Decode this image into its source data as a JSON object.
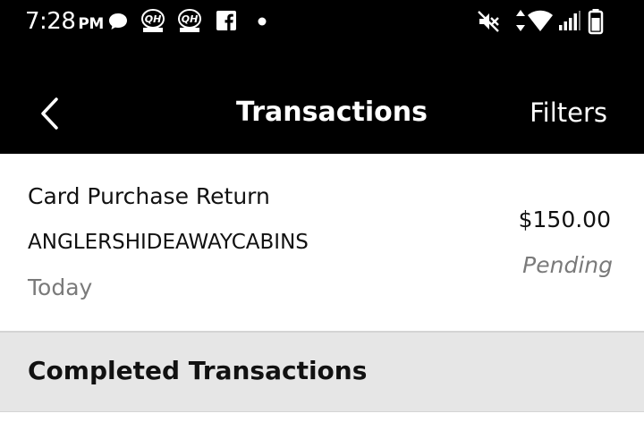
{
  "status_bar": {
    "time": "7:28",
    "ampm": "PM",
    "icons": [
      "chat-bubble-icon",
      "qh-slots-icon",
      "qh-slots-icon",
      "facebook-icon",
      "notification-dot-icon",
      "vibrate-off-icon",
      "data-arrows-icon",
      "wifi-icon",
      "signal-icon",
      "battery-icon"
    ],
    "qh_logo_text": "QH"
  },
  "app_bar": {
    "title": "Transactions",
    "filters_label": "Filters",
    "back_icon": "chevron-left-icon"
  },
  "pending_transaction": {
    "type": "Card Purchase Return",
    "merchant": "ANGLERSHIDEAWAYCABINS",
    "date": "Today",
    "amount": "$150.00",
    "status": "Pending"
  },
  "completed_section": {
    "title": "Completed Transactions"
  },
  "colors": {
    "bar_background": "#000000",
    "section_background": "#e6e6e6",
    "muted_text": "#7a7a7a"
  }
}
